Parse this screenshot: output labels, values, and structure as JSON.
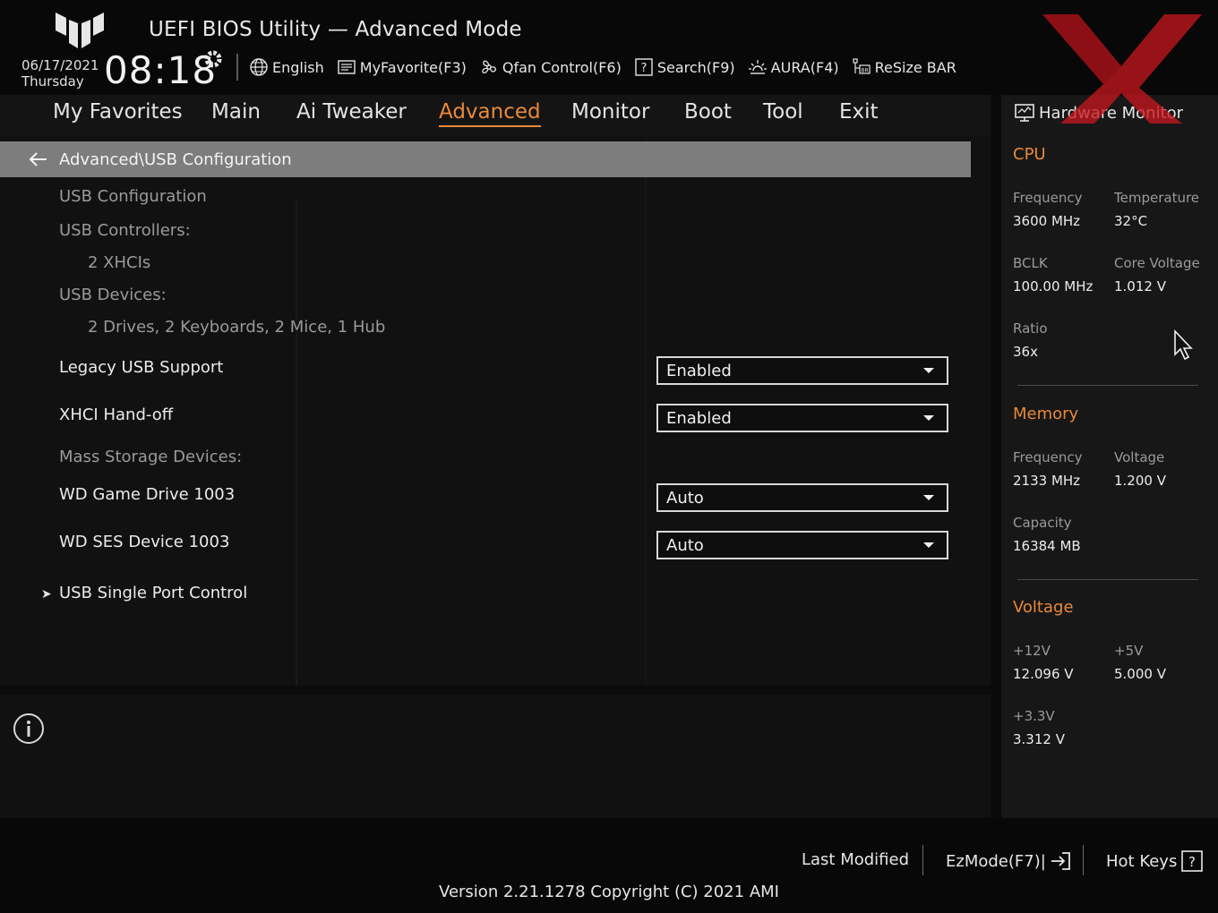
{
  "header": {
    "title": "UEFI BIOS Utility — Advanced Mode",
    "date": "06/17/2021",
    "weekday": "Thursday",
    "time": "08:18",
    "tools": [
      {
        "label": "English",
        "icon": "globe-icon"
      },
      {
        "label": "MyFavorite(F3)",
        "icon": "favorite-icon"
      },
      {
        "label": "Qfan Control(F6)",
        "icon": "fan-icon"
      },
      {
        "label": "Search(F9)",
        "icon": "search-help-icon"
      },
      {
        "label": "AURA(F4)",
        "icon": "aura-icon"
      },
      {
        "label": "ReSize BAR",
        "icon": "resize-bar-icon"
      }
    ]
  },
  "nav": {
    "tabs": [
      "My Favorites",
      "Main",
      "Ai Tweaker",
      "Advanced",
      "Monitor",
      "Boot",
      "Tool",
      "Exit"
    ],
    "active": "Advanced"
  },
  "page": {
    "breadcrumb": "Advanced\\USB Configuration",
    "items": {
      "usb_config": "USB Configuration",
      "usb_controllers": "USB Controllers:",
      "usb_controllers_val": "2 XHCIs",
      "usb_devices": "USB Devices:",
      "usb_devices_val": "2 Drives, 2 Keyboards, 2 Mice, 1 Hub",
      "legacy_usb": "Legacy USB Support",
      "legacy_usb_val": "Enabled",
      "xhci_handoff": "XHCI Hand-off",
      "xhci_handoff_val": "Enabled",
      "mass_storage": "Mass Storage Devices:",
      "wd_game": "WD Game Drive 1003",
      "wd_game_val": "Auto",
      "wd_ses": "WD SES Device 1003",
      "wd_ses_val": "Auto",
      "single_port": "USB Single Port Control"
    }
  },
  "hw_monitor": {
    "title": "Hardware Monitor",
    "cpu": {
      "heading": "CPU",
      "frequency_label": "Frequency",
      "frequency": "3600 MHz",
      "temperature_label": "Temperature",
      "temperature": "32°C",
      "bclk_label": "BCLK",
      "bclk": "100.00 MHz",
      "core_voltage_label": "Core Voltage",
      "core_voltage": "1.012 V",
      "ratio_label": "Ratio",
      "ratio": "36x"
    },
    "memory": {
      "heading": "Memory",
      "frequency_label": "Frequency",
      "frequency": "2133 MHz",
      "voltage_label": "Voltage",
      "voltage": "1.200 V",
      "capacity_label": "Capacity",
      "capacity": "16384 MB"
    },
    "voltage": {
      "heading": "Voltage",
      "v12_label": "+12V",
      "v12": "12.096 V",
      "v5_label": "+5V",
      "v5": "5.000 V",
      "v33_label": "+3.3V",
      "v33": "3.312 V"
    }
  },
  "footer": {
    "last_modified": "Last Modified",
    "ezmode": "EzMode(F7)|",
    "hotkeys": "Hot Keys",
    "version": "Version 2.21.1278 Copyright (C) 2021 AMI"
  },
  "colors": {
    "accent": "#e8893a",
    "background": "#111111",
    "breadcrumb_bar": "#7d7d7d",
    "watermark": "#c4161c"
  }
}
